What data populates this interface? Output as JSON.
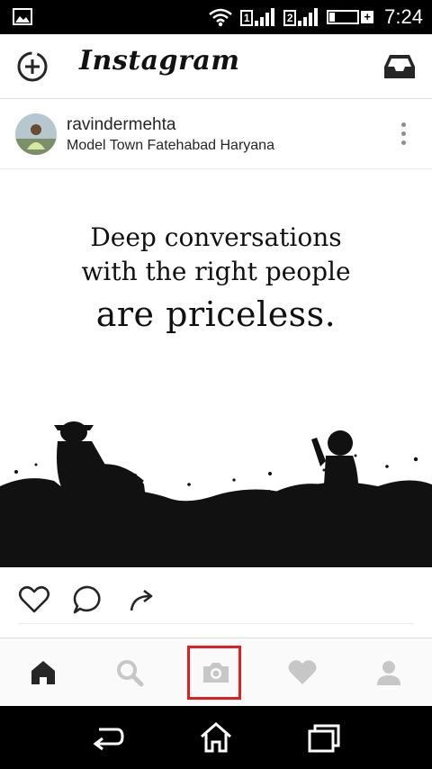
{
  "status_bar": {
    "time": "7:24",
    "sim1_label": "1",
    "sim2_label": "2",
    "icons": [
      "image-icon",
      "wifi-icon",
      "signal-icon",
      "battery-icon"
    ]
  },
  "app_bar": {
    "logo": "Instagram",
    "left_icon": "new-post-icon",
    "right_icon": "inbox-icon"
  },
  "post": {
    "username": "ravindermehta",
    "location": "Model Town Fatehabad Haryana",
    "image": {
      "line1": "Deep conversations",
      "line2": "with the right people",
      "line3": "are priceless."
    },
    "actions": [
      "heart-icon",
      "comment-icon",
      "share-icon"
    ]
  },
  "bottom_nav": {
    "items": [
      "home-icon",
      "search-icon",
      "camera-icon",
      "heart-icon",
      "profile-icon"
    ],
    "highlighted": "camera-icon",
    "highlight_color": "#e02020"
  },
  "system_nav": {
    "items": [
      "back-icon",
      "home-icon",
      "recents-icon"
    ]
  }
}
